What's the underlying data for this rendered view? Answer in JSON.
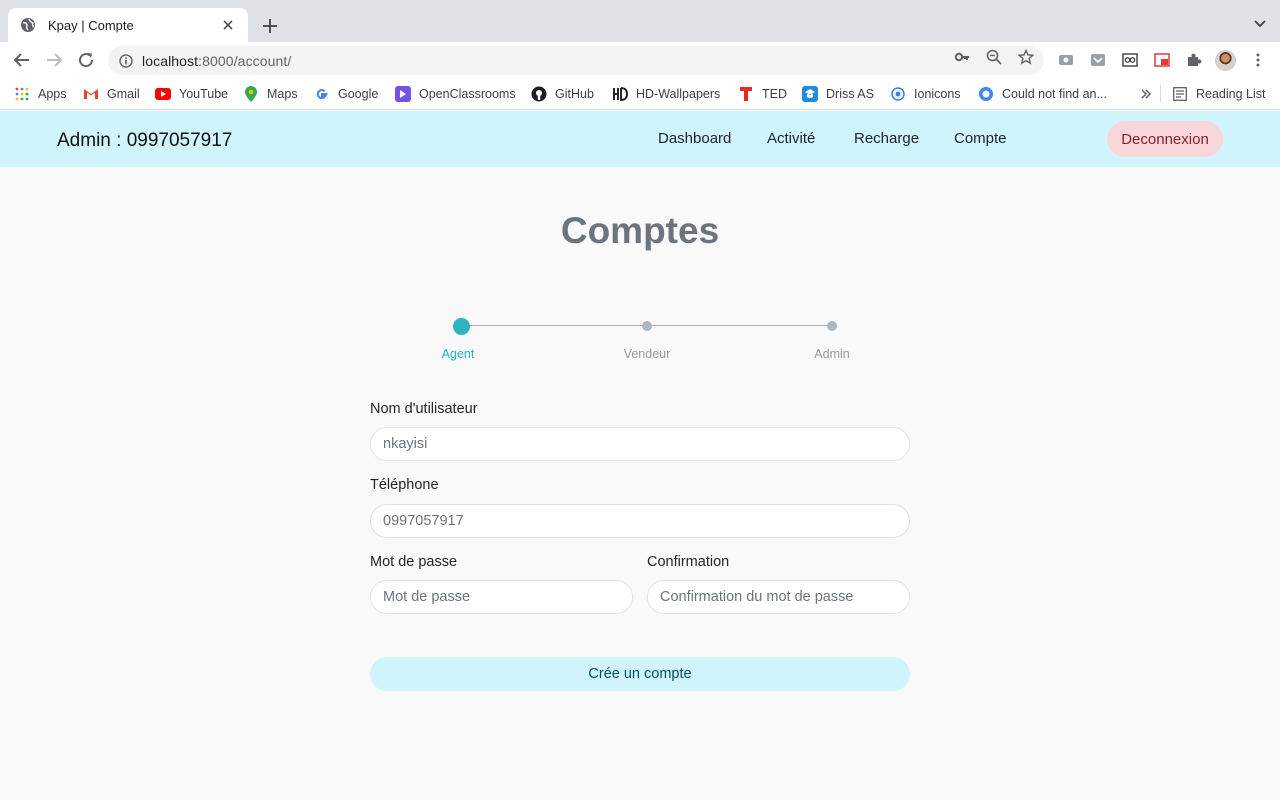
{
  "browser": {
    "tab_title": "Kpay | Compte",
    "url_host": "localhost",
    "url_rest": ":8000/account/",
    "bookmarks": [
      "Apps",
      "Gmail",
      "YouTube",
      "Maps",
      "Google",
      "OpenClassrooms",
      "GitHub",
      "HD-Wallpapers",
      "TED",
      "Driss AS",
      "Ionicons",
      "Could not find an..."
    ],
    "reading_list": "Reading List"
  },
  "header": {
    "brand": "Admin : 0997057917",
    "nav": [
      "Dashboard",
      "Activité",
      "Recharge",
      "Compte"
    ],
    "logout": "Deconnexion"
  },
  "main": {
    "title": "Comptes",
    "steps": [
      "Agent",
      "Vendeur",
      "Admin"
    ],
    "active_step": "Agent",
    "form": {
      "username_label": "Nom d'utilisateur",
      "username_value": "nkayisi",
      "phone_label": "Téléphone",
      "phone_value": "0997057917",
      "password_label": "Mot de passe",
      "password_placeholder": "Mot de passe",
      "confirm_label": "Confirmation",
      "confirm_placeholder": "Confirmation du mot de passe",
      "submit_label": "Crée un compte"
    }
  },
  "colors": {
    "appbar_bg": "#cff4fc",
    "logout_bg": "#f8d7da",
    "step_active": "#2bb3c0",
    "title": "#6c757d"
  }
}
